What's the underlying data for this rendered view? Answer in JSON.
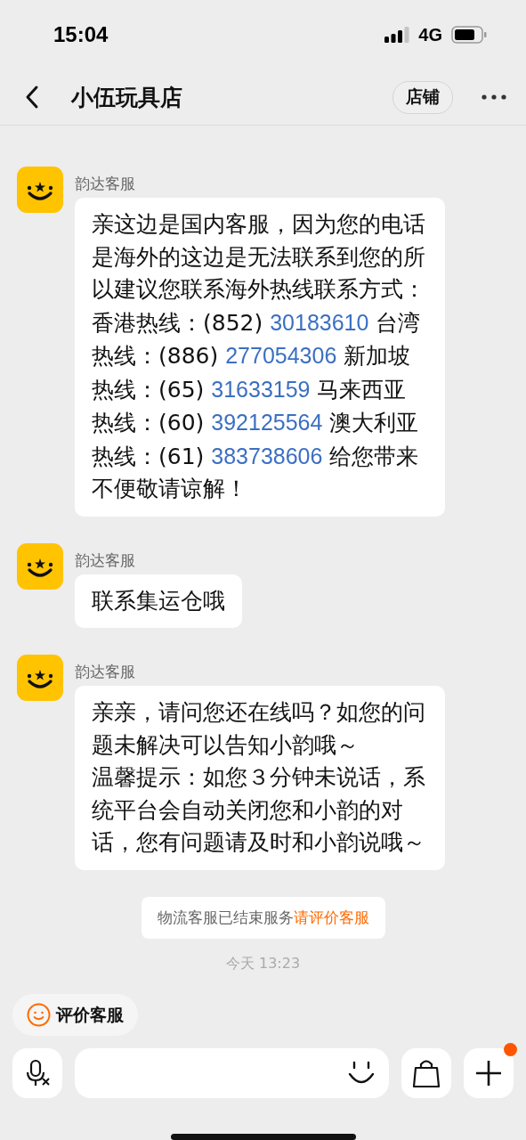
{
  "status_bar": {
    "time": "15:04",
    "network": "4G"
  },
  "header": {
    "title": "小伍玩具店",
    "shop_button": "店铺"
  },
  "messages": [
    {
      "kind": "bubble",
      "sender": "韵达客服",
      "segments": [
        {
          "kind": "plain",
          "text": "亲这边是国内客服，因为您的电话是海外的这边是无法联系到您的所以建议您联系海外热线联系方式：香港热线：(852) "
        },
        {
          "kind": "link",
          "text": "30183610"
        },
        {
          "kind": "plain",
          "text": " 台湾热线：(886) "
        },
        {
          "kind": "link",
          "text": "277054306"
        },
        {
          "kind": "plain",
          "text": " 新加坡热线：(65) "
        },
        {
          "kind": "link",
          "text": "31633159"
        },
        {
          "kind": "plain",
          "text": " 马来西亚热线：(60) "
        },
        {
          "kind": "link",
          "text": "392125564"
        },
        {
          "kind": "plain",
          "text": " 澳大利亚热线：(61) "
        },
        {
          "kind": "link",
          "text": "383738606"
        },
        {
          "kind": "plain",
          "text": " 给您带来不便敬请谅解！"
        }
      ]
    },
    {
      "kind": "bubble",
      "sender": "韵达客服",
      "segments": [
        {
          "kind": "plain",
          "text": "联系集运仓哦"
        }
      ]
    },
    {
      "kind": "bubble",
      "sender": "韵达客服",
      "segments": [
        {
          "kind": "paragraph",
          "text": "亲亲，请问您还在线吗？如您的问题未解决可以告知小韵哦～"
        },
        {
          "kind": "paragraph",
          "text": "温馨提示：如您３分钟未说话，系统平台会自动关闭您和小韵的对话，您有问题请及时和小韵说哦～"
        }
      ]
    },
    {
      "kind": "notice",
      "text": "物流客服已结束服务",
      "link": "请评价客服"
    },
    {
      "kind": "time",
      "text": "今天 13:23"
    }
  ],
  "rate_chip": "评价客服",
  "plus_badge": true
}
